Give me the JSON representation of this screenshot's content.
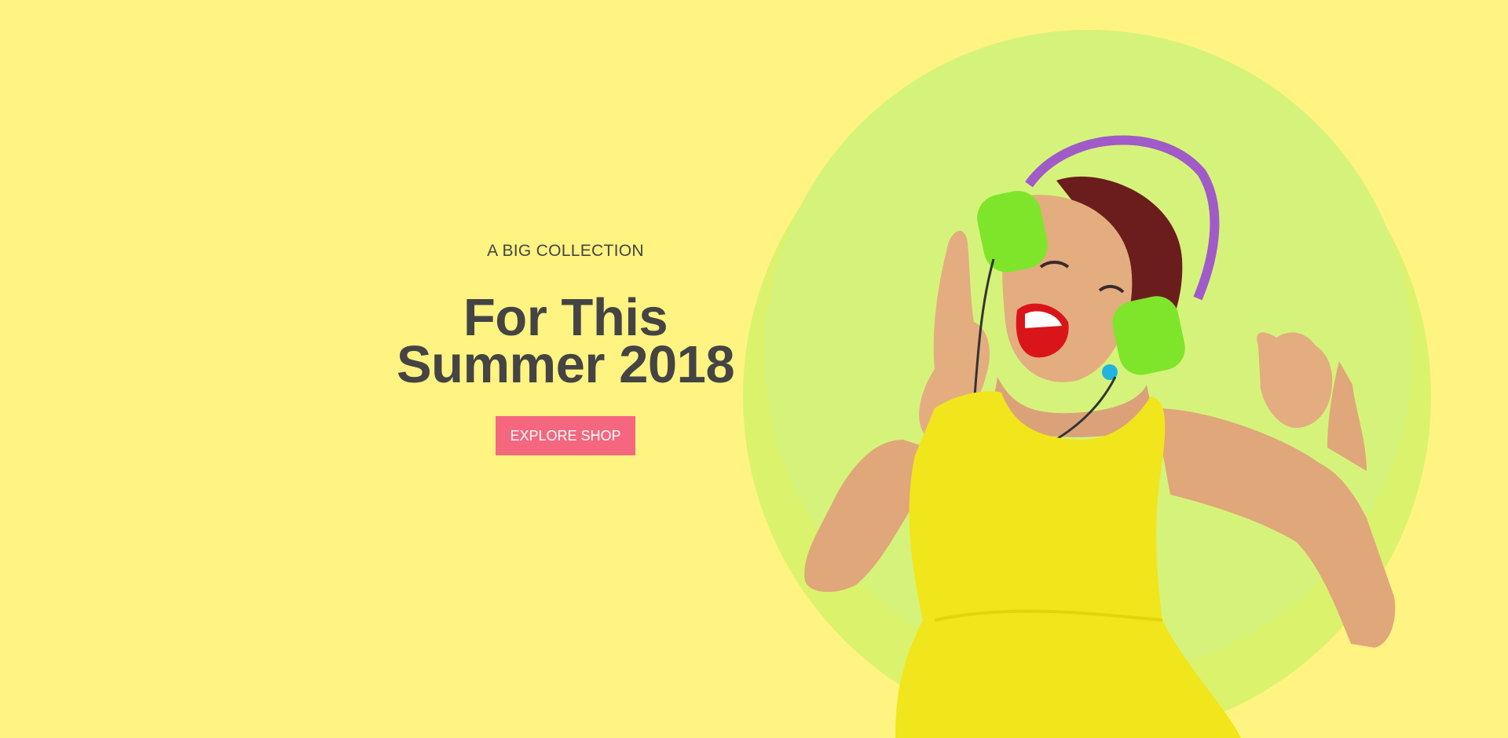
{
  "hero": {
    "eyebrow": "A BIG COLLECTION",
    "headline_line1": "For This",
    "headline_line2": "Summer 2018",
    "cta_label": "EXPLORE SHOP"
  },
  "colors": {
    "background": "#fff381",
    "circle_outer": "#dbf26d",
    "circle_inner": "#d5f37a",
    "text": "#444444",
    "cta": "#f5677f",
    "dress": "#f1e51b",
    "headphones": "#7fe52b",
    "headband": "#a05bc9",
    "skin": "#e0a77a",
    "lips": "#d9151a"
  },
  "icons": {
    "model": "woman-with-headphones-illustration"
  }
}
